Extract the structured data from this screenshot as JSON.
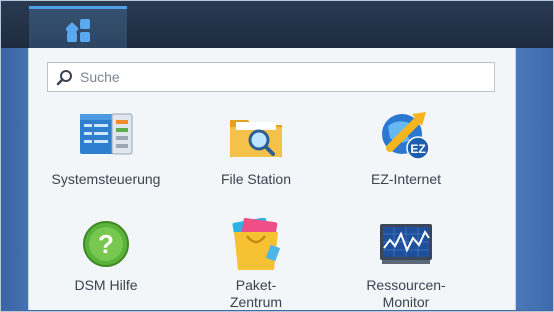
{
  "taskbar": {
    "main_menu_icon": "main-menu-icon"
  },
  "search": {
    "placeholder": "Suche",
    "icon": "search-icon"
  },
  "apps": [
    {
      "label": "Systemsteuerung",
      "icon": "control-panel-icon"
    },
    {
      "label": "File Station",
      "icon": "file-station-icon"
    },
    {
      "label": "EZ-Internet",
      "icon": "ez-internet-icon",
      "badge": "EZ"
    },
    {
      "label": "DSM Hilfe",
      "icon": "help-icon",
      "glyph": "?"
    },
    {
      "label_line1": "Paket-",
      "label_line2": "Zentrum",
      "icon": "package-center-icon"
    },
    {
      "label_line1": "Ressourcen-",
      "label_line2": "Monitor",
      "icon": "resource-monitor-icon"
    }
  ]
}
